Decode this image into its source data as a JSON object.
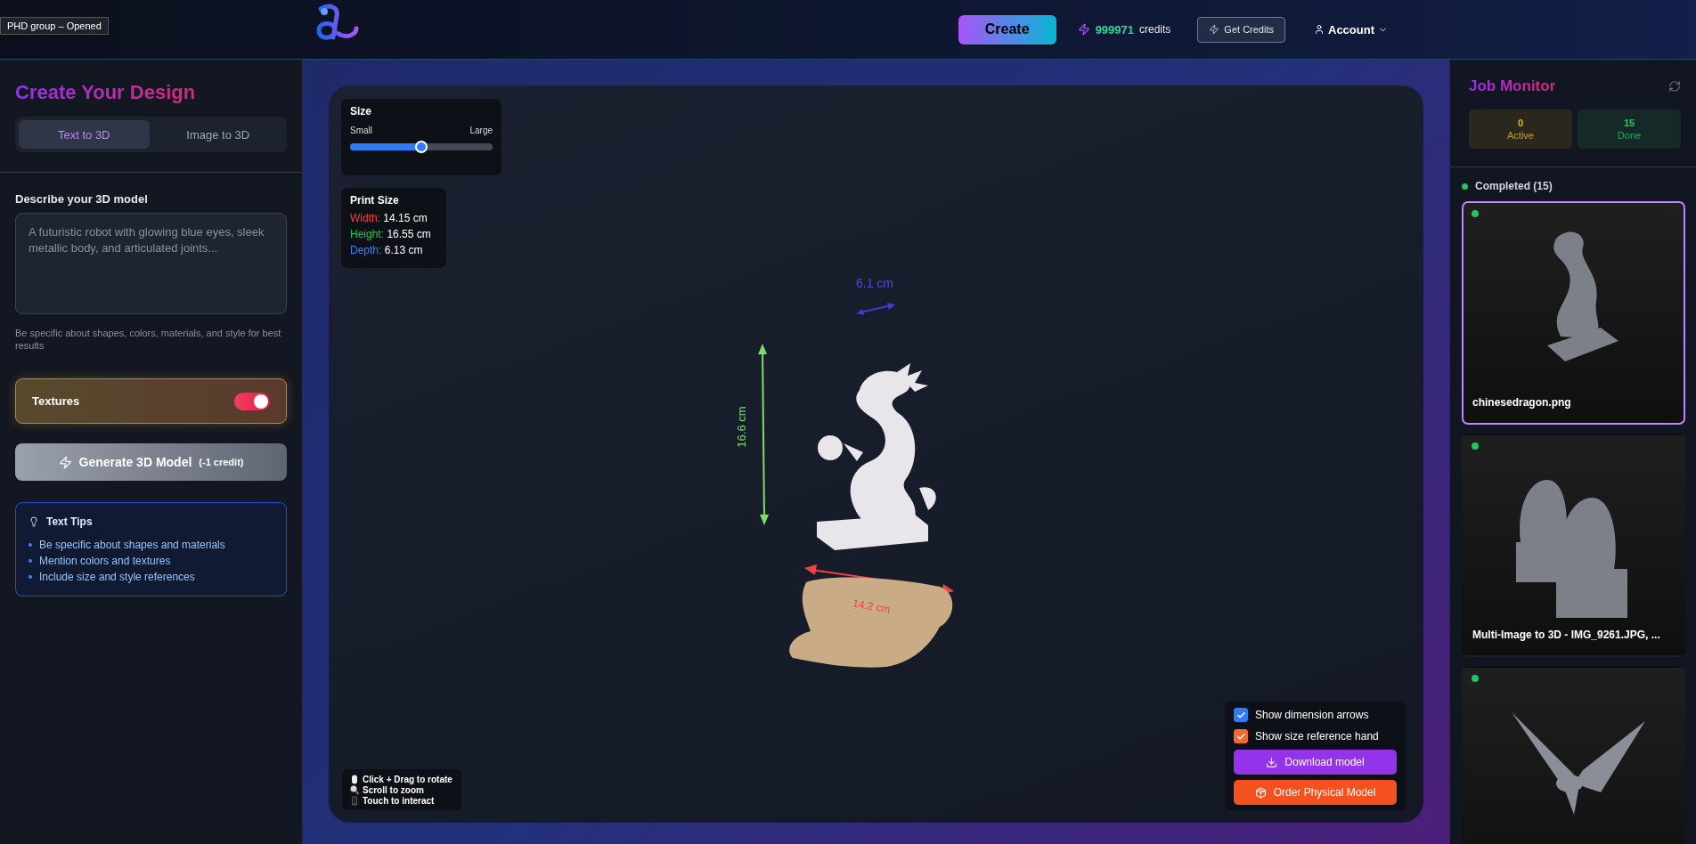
{
  "header": {
    "tag": "PHD group – Opened",
    "create_button": "Create",
    "credits_value": "999971",
    "credits_label": "credits",
    "get_credits_button": "Get Credits",
    "account_menu": "Account"
  },
  "sidebar": {
    "title": "Create Your Design",
    "tabs": [
      {
        "label": "Text to 3D",
        "selected": true
      },
      {
        "label": "Image to 3D",
        "selected": false
      }
    ],
    "prompt": {
      "label": "Describe your 3D model",
      "placeholder": "A futuristic robot with glowing blue eyes, sleek metallic body, and articulated joints...",
      "hint": "Be specific about shapes, colors, materials, and style for best results"
    },
    "textures": {
      "label": "Textures",
      "on": true
    },
    "generate_button": {
      "label": "Generate 3D Model",
      "cost": "(-1 credit)",
      "disabled": true
    },
    "tips": {
      "title": "Text Tips",
      "items": [
        "Be specific about shapes and materials",
        "Mention colors and textures",
        "Include size and style references"
      ]
    }
  },
  "viewer": {
    "size_slider": {
      "title": "Size",
      "min_label": "Small",
      "max_label": "Large",
      "level": 0.5
    },
    "print_size": {
      "title": "Print Size",
      "rows": [
        {
          "label": "Width:",
          "value": "14.15 cm",
          "color": "#ef4444"
        },
        {
          "label": "Height:",
          "value": "16.55 cm",
          "color": "#22c55e"
        },
        {
          "label": "Depth:",
          "value": "6.13 cm",
          "color": "#3b82f6"
        }
      ]
    },
    "dimension_labels": {
      "depth": "6.1 cm",
      "height": "16.6 cm",
      "width": "14.2 cm"
    },
    "hints": [
      {
        "kind": "mouse",
        "text": "Click + Drag to rotate"
      },
      {
        "kind": "zoom",
        "text": "Scroll to zoom"
      },
      {
        "kind": "touch",
        "text": "Touch to interact"
      }
    ],
    "options": [
      {
        "label": "Show dimension arrows",
        "checked": true,
        "color": "#2f7cf6"
      },
      {
        "label": "Show size reference hand",
        "checked": true,
        "color": "#f26a2e"
      }
    ],
    "download_button": "Download model",
    "order_button": "Order Physical Model"
  },
  "job_monitor": {
    "title": "Job Monitor",
    "stats": [
      {
        "value": "0",
        "label": "Active",
        "color": "#eab308"
      },
      {
        "value": "15",
        "label": "Done",
        "color": "#22c55e"
      }
    ],
    "section": "Completed (15)",
    "jobs": [
      {
        "kind": "dragon",
        "title": "chinesedragon.png",
        "selected": true
      },
      {
        "kind": "lions",
        "title": "Multi-Image to 3D - IMG_9261.JPG, ...",
        "selected": false
      },
      {
        "kind": "bird",
        "selected": false
      }
    ]
  }
}
